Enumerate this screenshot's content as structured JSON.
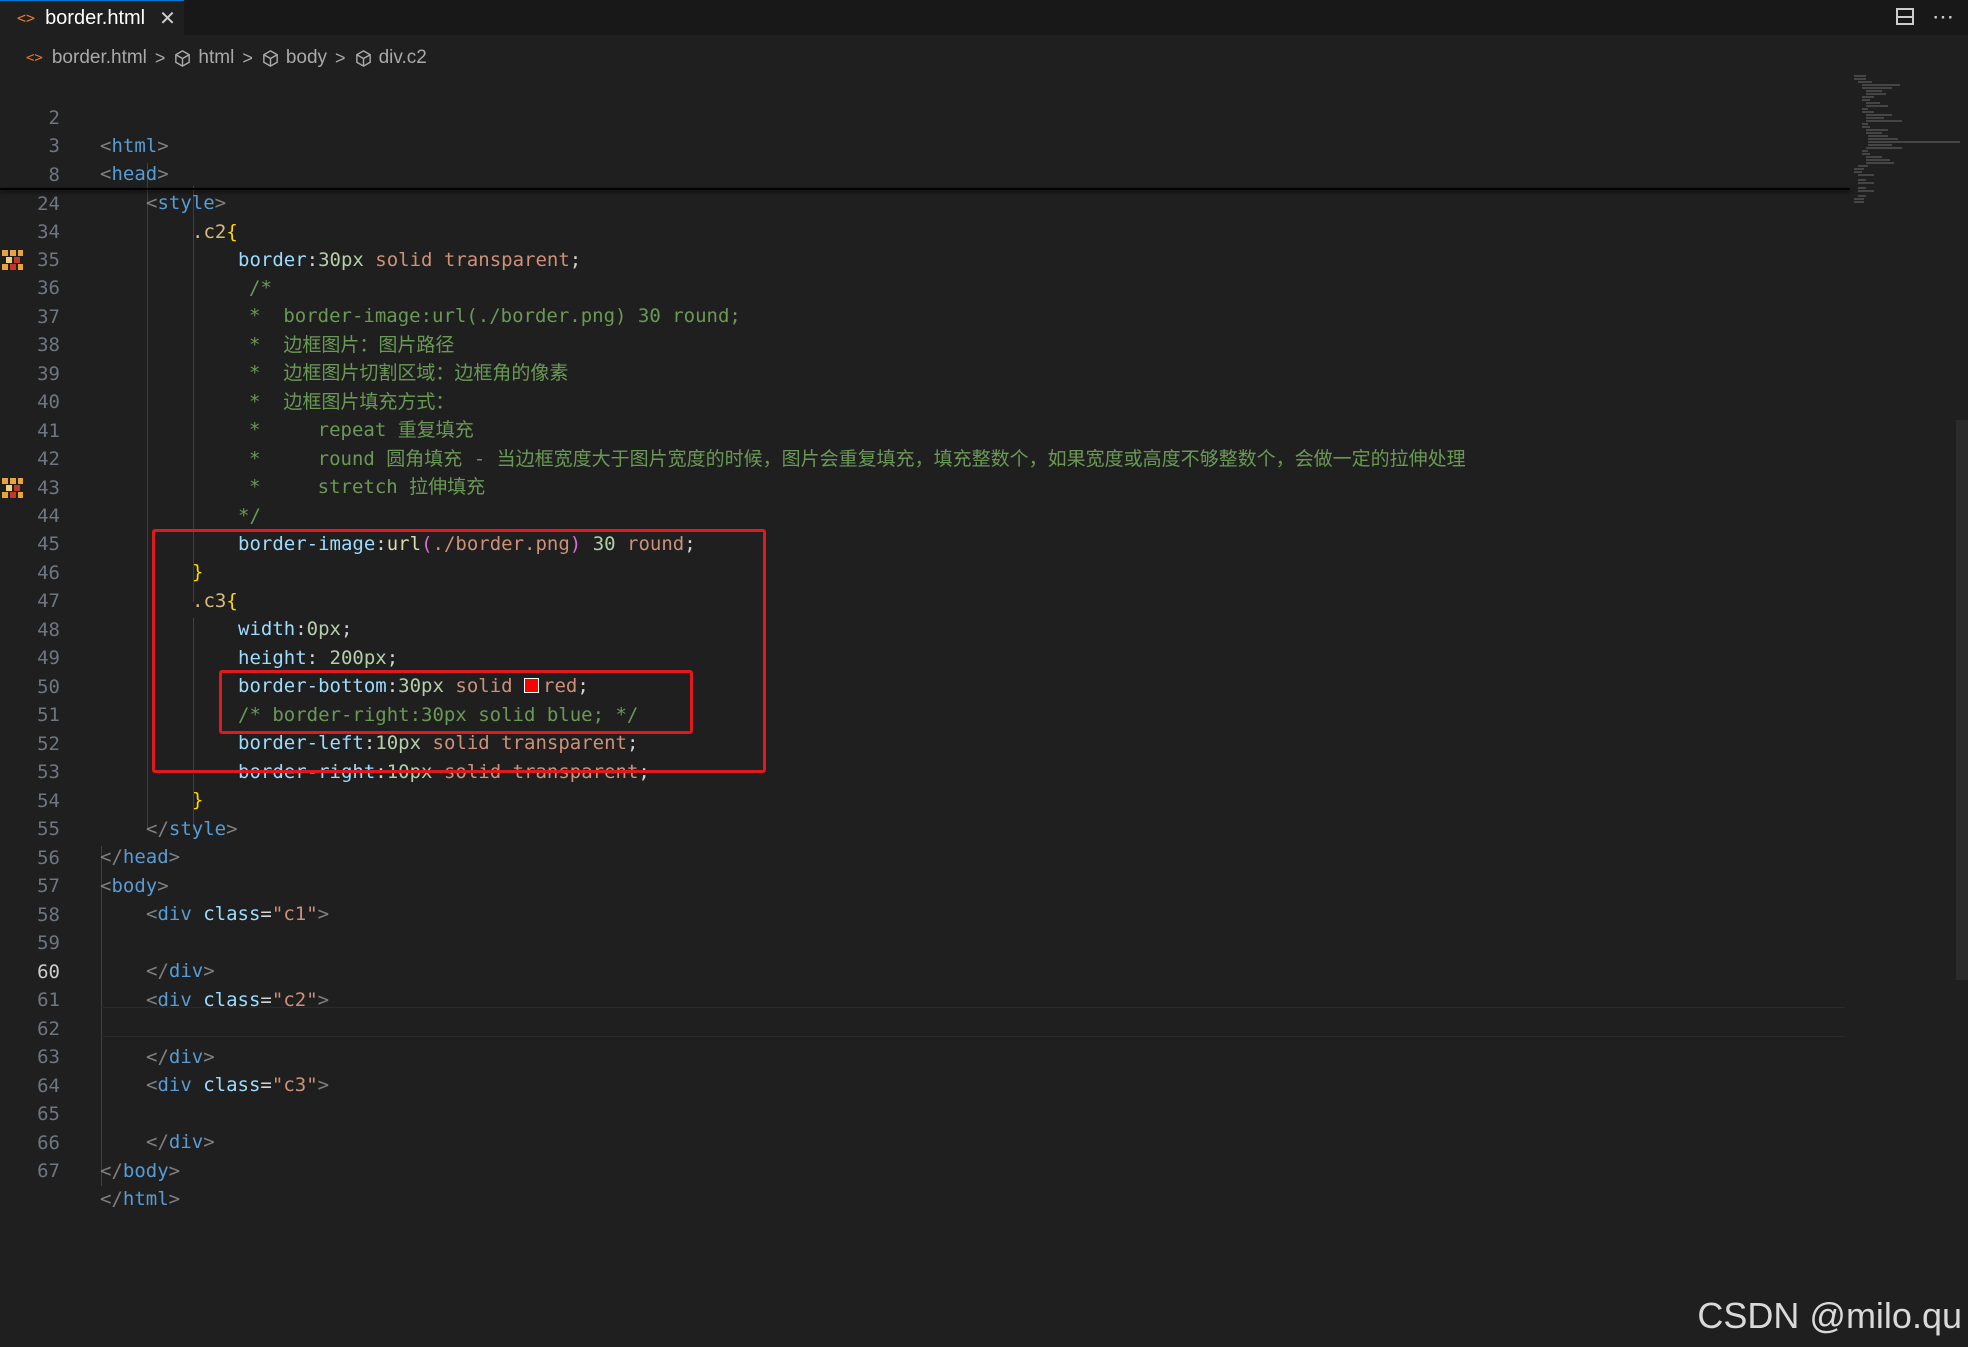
{
  "tab": {
    "icon": "<>",
    "label": "border.html",
    "close": "✕"
  },
  "bar_actions": {
    "split": "split-editor-icon",
    "more": "⋯"
  },
  "breadcrumb": {
    "file": "border.html",
    "items": [
      "html",
      "body",
      "div.c2"
    ]
  },
  "lines": {
    "l2": {
      "n": "2",
      "a": "<",
      "b": "html",
      "c": ">"
    },
    "l3": {
      "n": "3",
      "a": "<",
      "b": "head",
      "c": ">"
    },
    "l8": {
      "n": "8",
      "a": "<",
      "b": "style",
      "c": ">"
    },
    "l24": {
      "n": "24",
      "a": ".c2",
      "b": "{"
    },
    "l34": {
      "n": "34",
      "a": "border",
      "b": ":",
      "c": "30px",
      "d": " solid transparent",
      "e": ";"
    },
    "l35": {
      "n": "35",
      "a": "/*"
    },
    "l36": {
      "n": "36",
      "a": "*  border-image:url(./border.png) 30 round;"
    },
    "l37": {
      "n": "37",
      "a": "*  边框图片：图片路径"
    },
    "l38": {
      "n": "38",
      "a": "*  边框图片切割区域：边框角的像素"
    },
    "l39": {
      "n": "39",
      "a": "*  边框图片填充方式："
    },
    "l40": {
      "n": "40",
      "a": "*     repeat 重复填充"
    },
    "l41": {
      "n": "41",
      "a": "*     round 圆角填充 - 当边框宽度大于图片宽度的时候，图片会重复填充，填充整数个，如果宽度或高度不够整数个，会做一定的拉伸处理"
    },
    "l42": {
      "n": "42",
      "a": "*     stretch 拉伸填充"
    },
    "l43": {
      "n": "43",
      "a": "*/"
    },
    "l44": {
      "n": "44",
      "a": "border-image",
      "b": ":",
      "c": "url",
      "d": "(",
      "e": "./border.png",
      "f": ")",
      "g": " ",
      "h": "30",
      "i": " round",
      "j": ";"
    },
    "l45": {
      "n": "45",
      "a": "}"
    },
    "l46": {
      "n": "46",
      "a": ".c3",
      "b": "{"
    },
    "l47": {
      "n": "47",
      "a": "width",
      "b": ":",
      "c": "0px",
      "d": ";"
    },
    "l48": {
      "n": "48",
      "a": "height",
      "b": ": ",
      "c": "200px",
      "d": ";"
    },
    "l49": {
      "n": "49",
      "a": "border-bottom",
      "b": ":",
      "c": "30px",
      "d": " solid ",
      "e": "red",
      "f": ";"
    },
    "l50": {
      "n": "50",
      "a": "/* border-right:30px solid blue; */"
    },
    "l51": {
      "n": "51",
      "a": "border-left",
      "b": ":",
      "c": "10px",
      "d": " solid transparent",
      "e": ";"
    },
    "l52": {
      "n": "52",
      "a": "border-right",
      "b": ":",
      "c": "10px",
      "d": " solid transparent",
      "e": ";"
    },
    "l53": {
      "n": "53",
      "a": "}"
    },
    "l54": {
      "n": "54",
      "a": "</",
      "b": "style",
      "c": ">"
    },
    "l55": {
      "n": "55",
      "a": "</",
      "b": "head",
      "c": ">"
    },
    "l56": {
      "n": "56",
      "a": "<",
      "b": "body",
      "c": ">"
    },
    "l57": {
      "n": "57",
      "a": "<",
      "b": "div",
      "c": " class",
      "d": "=",
      "e": "\"c1\"",
      "f": ">"
    },
    "l58": {
      "n": "58"
    },
    "l59": {
      "n": "59",
      "a": "</",
      "b": "div",
      "c": ">"
    },
    "l60": {
      "n": "60",
      "a": "<",
      "b": "div",
      "c": " class",
      "d": "=",
      "e": "\"c2\"",
      "f": ">"
    },
    "l61": {
      "n": "61"
    },
    "l62": {
      "n": "62",
      "a": "</",
      "b": "div",
      "c": ">"
    },
    "l63": {
      "n": "63",
      "a": "<",
      "b": "div",
      "c": " class",
      "d": "=",
      "e": "\"c3\"",
      "f": ">"
    },
    "l64": {
      "n": "64"
    },
    "l65": {
      "n": "65",
      "a": "</",
      "b": "div",
      "c": ">"
    },
    "l66": {
      "n": "66",
      "a": "</",
      "b": "body",
      "c": ">"
    },
    "l67": {
      "n": "67",
      "a": "</",
      "b": "html",
      "c": ">"
    }
  },
  "colors": {
    "highlight_box": "#e0191e",
    "swatch": "#ff0000"
  },
  "watermark": "CSDN @milo.qu"
}
